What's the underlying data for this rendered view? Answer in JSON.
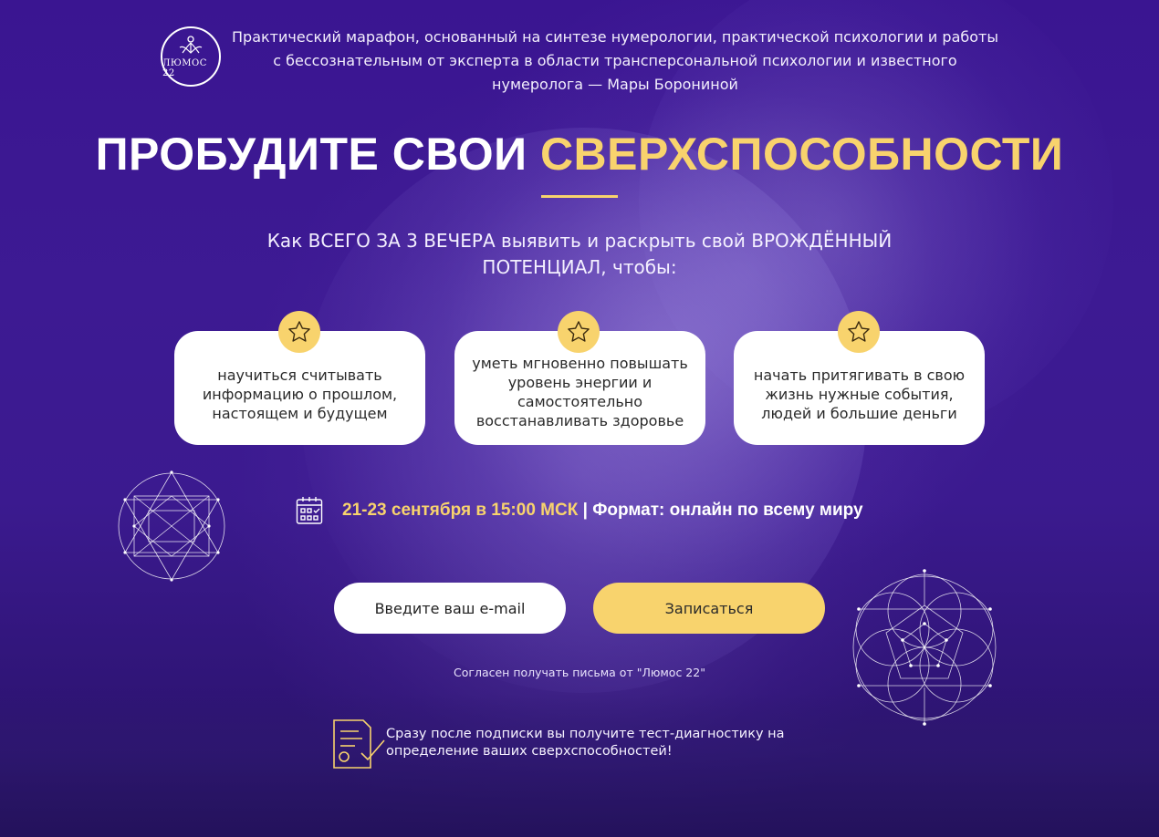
{
  "header": {
    "logo_text": "ЛЮМОС 22",
    "intro_text": "Практический марафон, основанный на синтезе нумерологии, практической психологии и работы с бессознательным от эксперта в области трансперсональной психологии и известного нумеролога — Мары Борониной"
  },
  "hero": {
    "title_white": "ПРОБУДИТЕ СВОИ",
    "title_accent": "СВЕРХСПОСОБНОСТИ",
    "subtitle": "Как ВСЕГО ЗА 3 ВЕЧЕРА выявить и раскрыть свой ВРОЖДЁННЫЙ ПОТЕНЦИАЛ, чтобы:"
  },
  "benefits": [
    {
      "icon": "star-icon",
      "text": "научиться считывать информацию о прошлом, настоящем и будущем"
    },
    {
      "icon": "star-icon",
      "text": "уметь мгновенно повышать уровень энергии и самостоятельно восстанавливать здоровье"
    },
    {
      "icon": "star-icon",
      "text": "начать притягивать в свою жизнь нужные события, людей и большие деньги"
    }
  ],
  "event": {
    "icon": "calendar-icon",
    "date": "21-23 сентября в 15:00 МСК",
    "separator": "|",
    "format": "Формат: онлайн по всему миру"
  },
  "form": {
    "email_placeholder": "Введите ваш e-mail",
    "submit_label": "Записаться",
    "consent_text": "Согласен получать письма от \"Люмос 22\""
  },
  "bonus": {
    "icon": "document-check-icon",
    "text": "Сразу после подписки вы получите тест-диагностику на определение ваших сверхспособностей!"
  },
  "colors": {
    "accent": "#f8d36d",
    "background": "#3a1591",
    "card": "#ffffff"
  }
}
